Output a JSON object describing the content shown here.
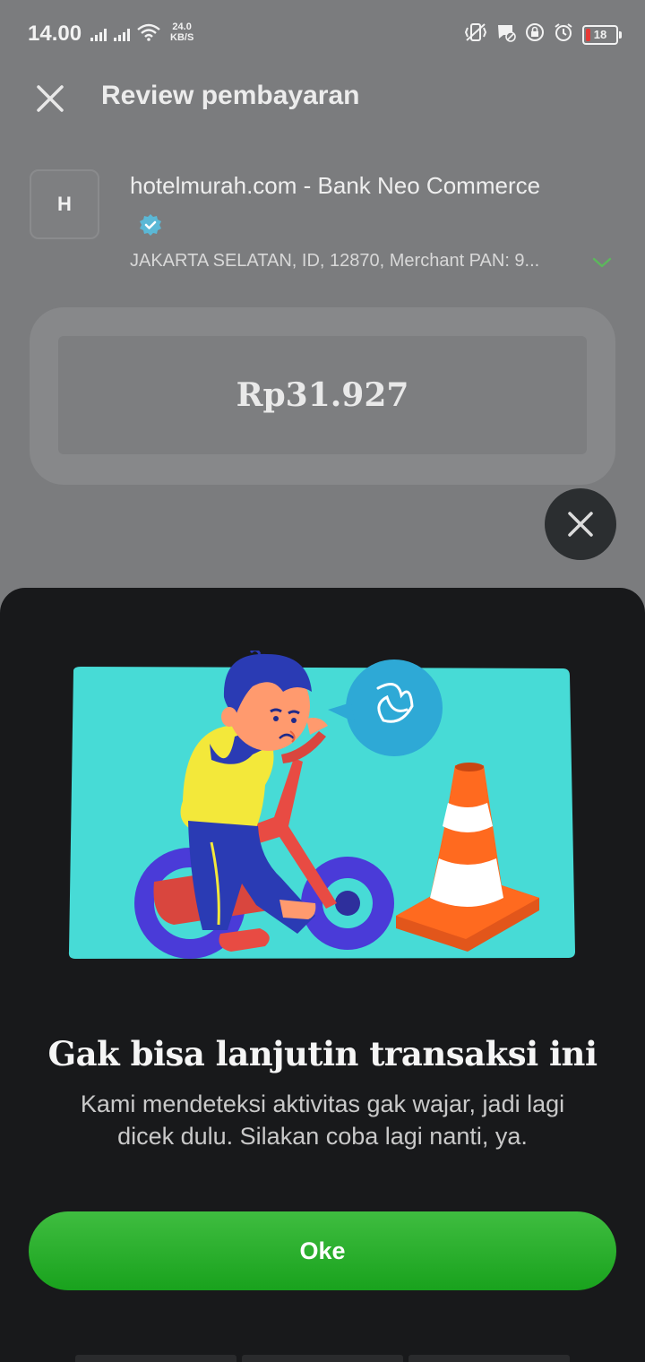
{
  "status_bar": {
    "time": "14.00",
    "network_speed_value": "24.0",
    "network_speed_unit": "KB/S",
    "battery_level": "18"
  },
  "header": {
    "title": "Review pembayaran"
  },
  "merchant": {
    "avatar_letter": "H",
    "name": "hotelmurah.com - Bank Neo Commerce",
    "address": "JAKARTA SELATAN, ID, 12870, Merchant PAN: 9..."
  },
  "payment": {
    "amount": "Rp31.927"
  },
  "sheet": {
    "title": "Gak bisa lanjutin transaksi ini",
    "message": "Kami mendeteksi aktivitas gak wajar, jadi lagi dicek dulu. Silakan coba lagi nanti, ya.",
    "ok_label": "Oke"
  },
  "colors": {
    "accent": "#19a21d",
    "sheet_background": "#18191b",
    "illustration_background": "#47dbd6",
    "verified_badge": "#5bb8d6"
  }
}
